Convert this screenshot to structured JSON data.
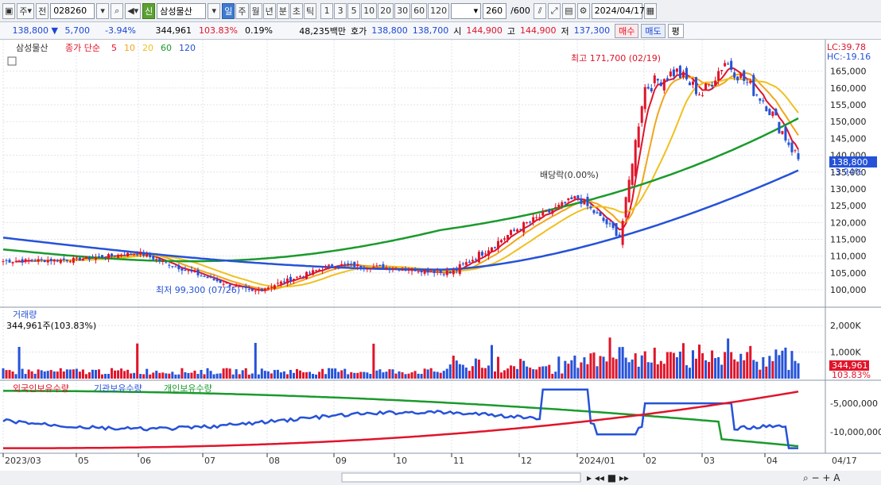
{
  "toolbar": {
    "stock_code": "028260",
    "stock_name": "삼성물산",
    "market_tag": "신",
    "period_tabs": [
      "일",
      "주",
      "월",
      "년",
      "분",
      "초",
      "틱"
    ],
    "interval_tabs": [
      "1",
      "3",
      "5",
      "10",
      "20",
      "30",
      "60",
      "120"
    ],
    "count": "260",
    "total": "/600",
    "date": "2024/04/17",
    "labels": {
      "jong": "주",
      "jeon": "전"
    }
  },
  "quote": {
    "price": "138,800",
    "change": "5,700",
    "change_pct": "-3.94%",
    "volume": "344,961",
    "vol_ratio": "103.83%",
    "turnover": "0.19%",
    "amount": "48,235백만",
    "bid_label": "호가",
    "bid": "138,800",
    "ask": "138,700",
    "open_label": "시",
    "open": "144,900",
    "high_label": "고",
    "high": "144,900",
    "low_label": "저",
    "low": "137,300",
    "buy_label": "매수",
    "sell_label": "매도",
    "eval_label": "평"
  },
  "panels": {
    "price": {
      "name": "삼성물산",
      "indicator": "종가 단순",
      "ma_periods": [
        "5",
        "10",
        "20",
        "60",
        "120"
      ],
      "lc": "LC:39.78",
      "hc": "HC:-19.16",
      "current": "138,800",
      "current_pct": "-3.94%",
      "high_note": "최고 171,700 (02/19)",
      "low_note": "최저 99,300 (07/26)",
      "div_note": "배당락(0.00%)"
    },
    "volume": {
      "title": "거래량",
      "value": "344,961주(103.83%)",
      "current": "344,961",
      "current_pct": "103.83%"
    },
    "holders": {
      "foreign": "외국인보유수량",
      "inst": "기관보유수량",
      "indiv": "개인보유수량"
    },
    "date_end": "04/17"
  },
  "colors": {
    "ma5": "#e0142a",
    "ma10": "#f1a51c",
    "ma20": "#f0c020",
    "ma60": "#1a9a2c",
    "ma120": "#2552d8",
    "up": "#e0142a",
    "down": "#2552d8"
  },
  "chart_data": {
    "type": "candlestick",
    "series": [
      {
        "name": "삼성물산 일봉",
        "anchors_x": [
          "2023/03",
          "2023/05",
          "2023/06",
          "2023/07",
          "2023/07/26",
          "2023/09",
          "2023/10",
          "2023/11",
          "2023/12",
          "2024/01",
          "2024/01/15",
          "2024/02",
          "2024/02/19",
          "2024/03",
          "2024/03/15",
          "2024/04",
          "2024/04/17"
        ],
        "close": [
          108500,
          109000,
          111000,
          104000,
          99300,
          107500,
          106500,
          105000,
          118500,
          127500,
          116000,
          160000,
          165000,
          158000,
          168000,
          156000,
          138800
        ]
      },
      {
        "name": "120",
        "start": 115500,
        "end": 135500
      },
      {
        "name": "60",
        "start": 112000,
        "end": 151000
      }
    ],
    "y_ticks": [
      100000,
      105000,
      110000,
      115000,
      120000,
      125000,
      130000,
      135000,
      140000,
      145000,
      150000,
      155000,
      160000,
      165000
    ],
    "y_labels": [
      "100,000",
      "105,000",
      "110,000",
      "115,000",
      "120,000",
      "125,000",
      "130,000",
      "135,000",
      "140,000",
      "145,000",
      "150,000",
      "155,000",
      "160,000",
      "165,000"
    ],
    "x_labels": [
      "2023/03",
      "05",
      "06",
      "07",
      "08",
      "09",
      "10",
      "11",
      "12",
      "2024/01",
      "02",
      "03",
      "04"
    ],
    "ylim": [
      96000,
      172000
    ],
    "volume_ticks": [
      "1,000K",
      "2,000K"
    ],
    "holders_ticks": [
      "-5,000,000",
      "-10,000,000"
    ]
  }
}
